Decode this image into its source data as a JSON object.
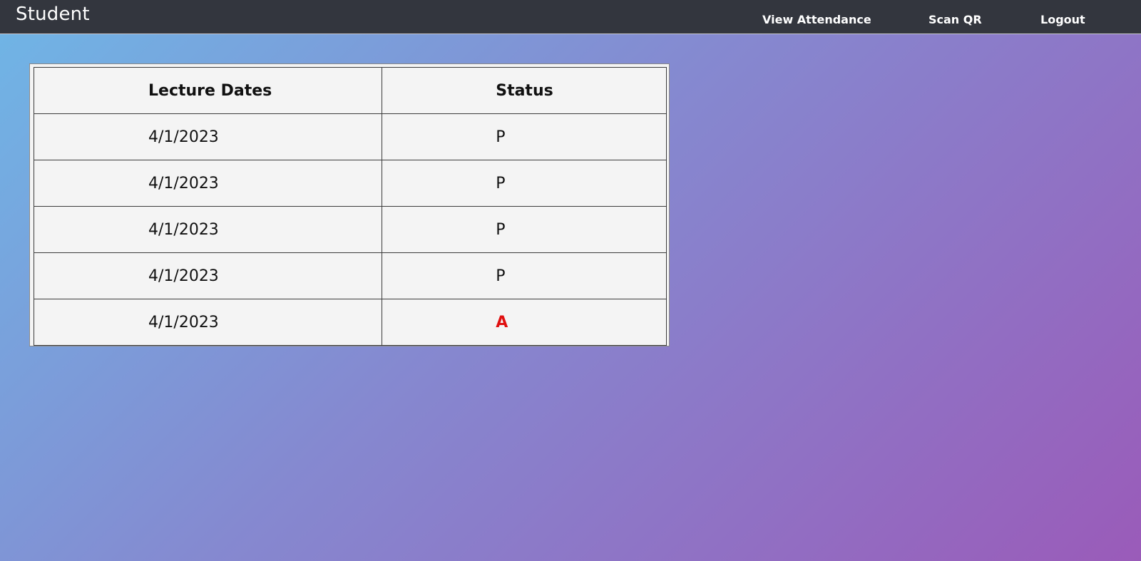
{
  "navbar": {
    "brand": "Student",
    "links": {
      "view_attendance": "View Attendance",
      "scan_qr": "Scan QR",
      "logout": "Logout"
    }
  },
  "table": {
    "headers": {
      "date": "Lecture Dates",
      "status": "Status"
    },
    "rows": [
      {
        "date": "4/1/2023",
        "status": "P"
      },
      {
        "date": "4/1/2023",
        "status": "P"
      },
      {
        "date": "4/1/2023",
        "status": "P"
      },
      {
        "date": "4/1/2023",
        "status": "P"
      },
      {
        "date": "4/1/2023",
        "status": "A"
      }
    ]
  },
  "colors": {
    "navbar_bg": "#33363e",
    "absent_status": "#e01010",
    "table_bg": "#f4f4f4"
  }
}
